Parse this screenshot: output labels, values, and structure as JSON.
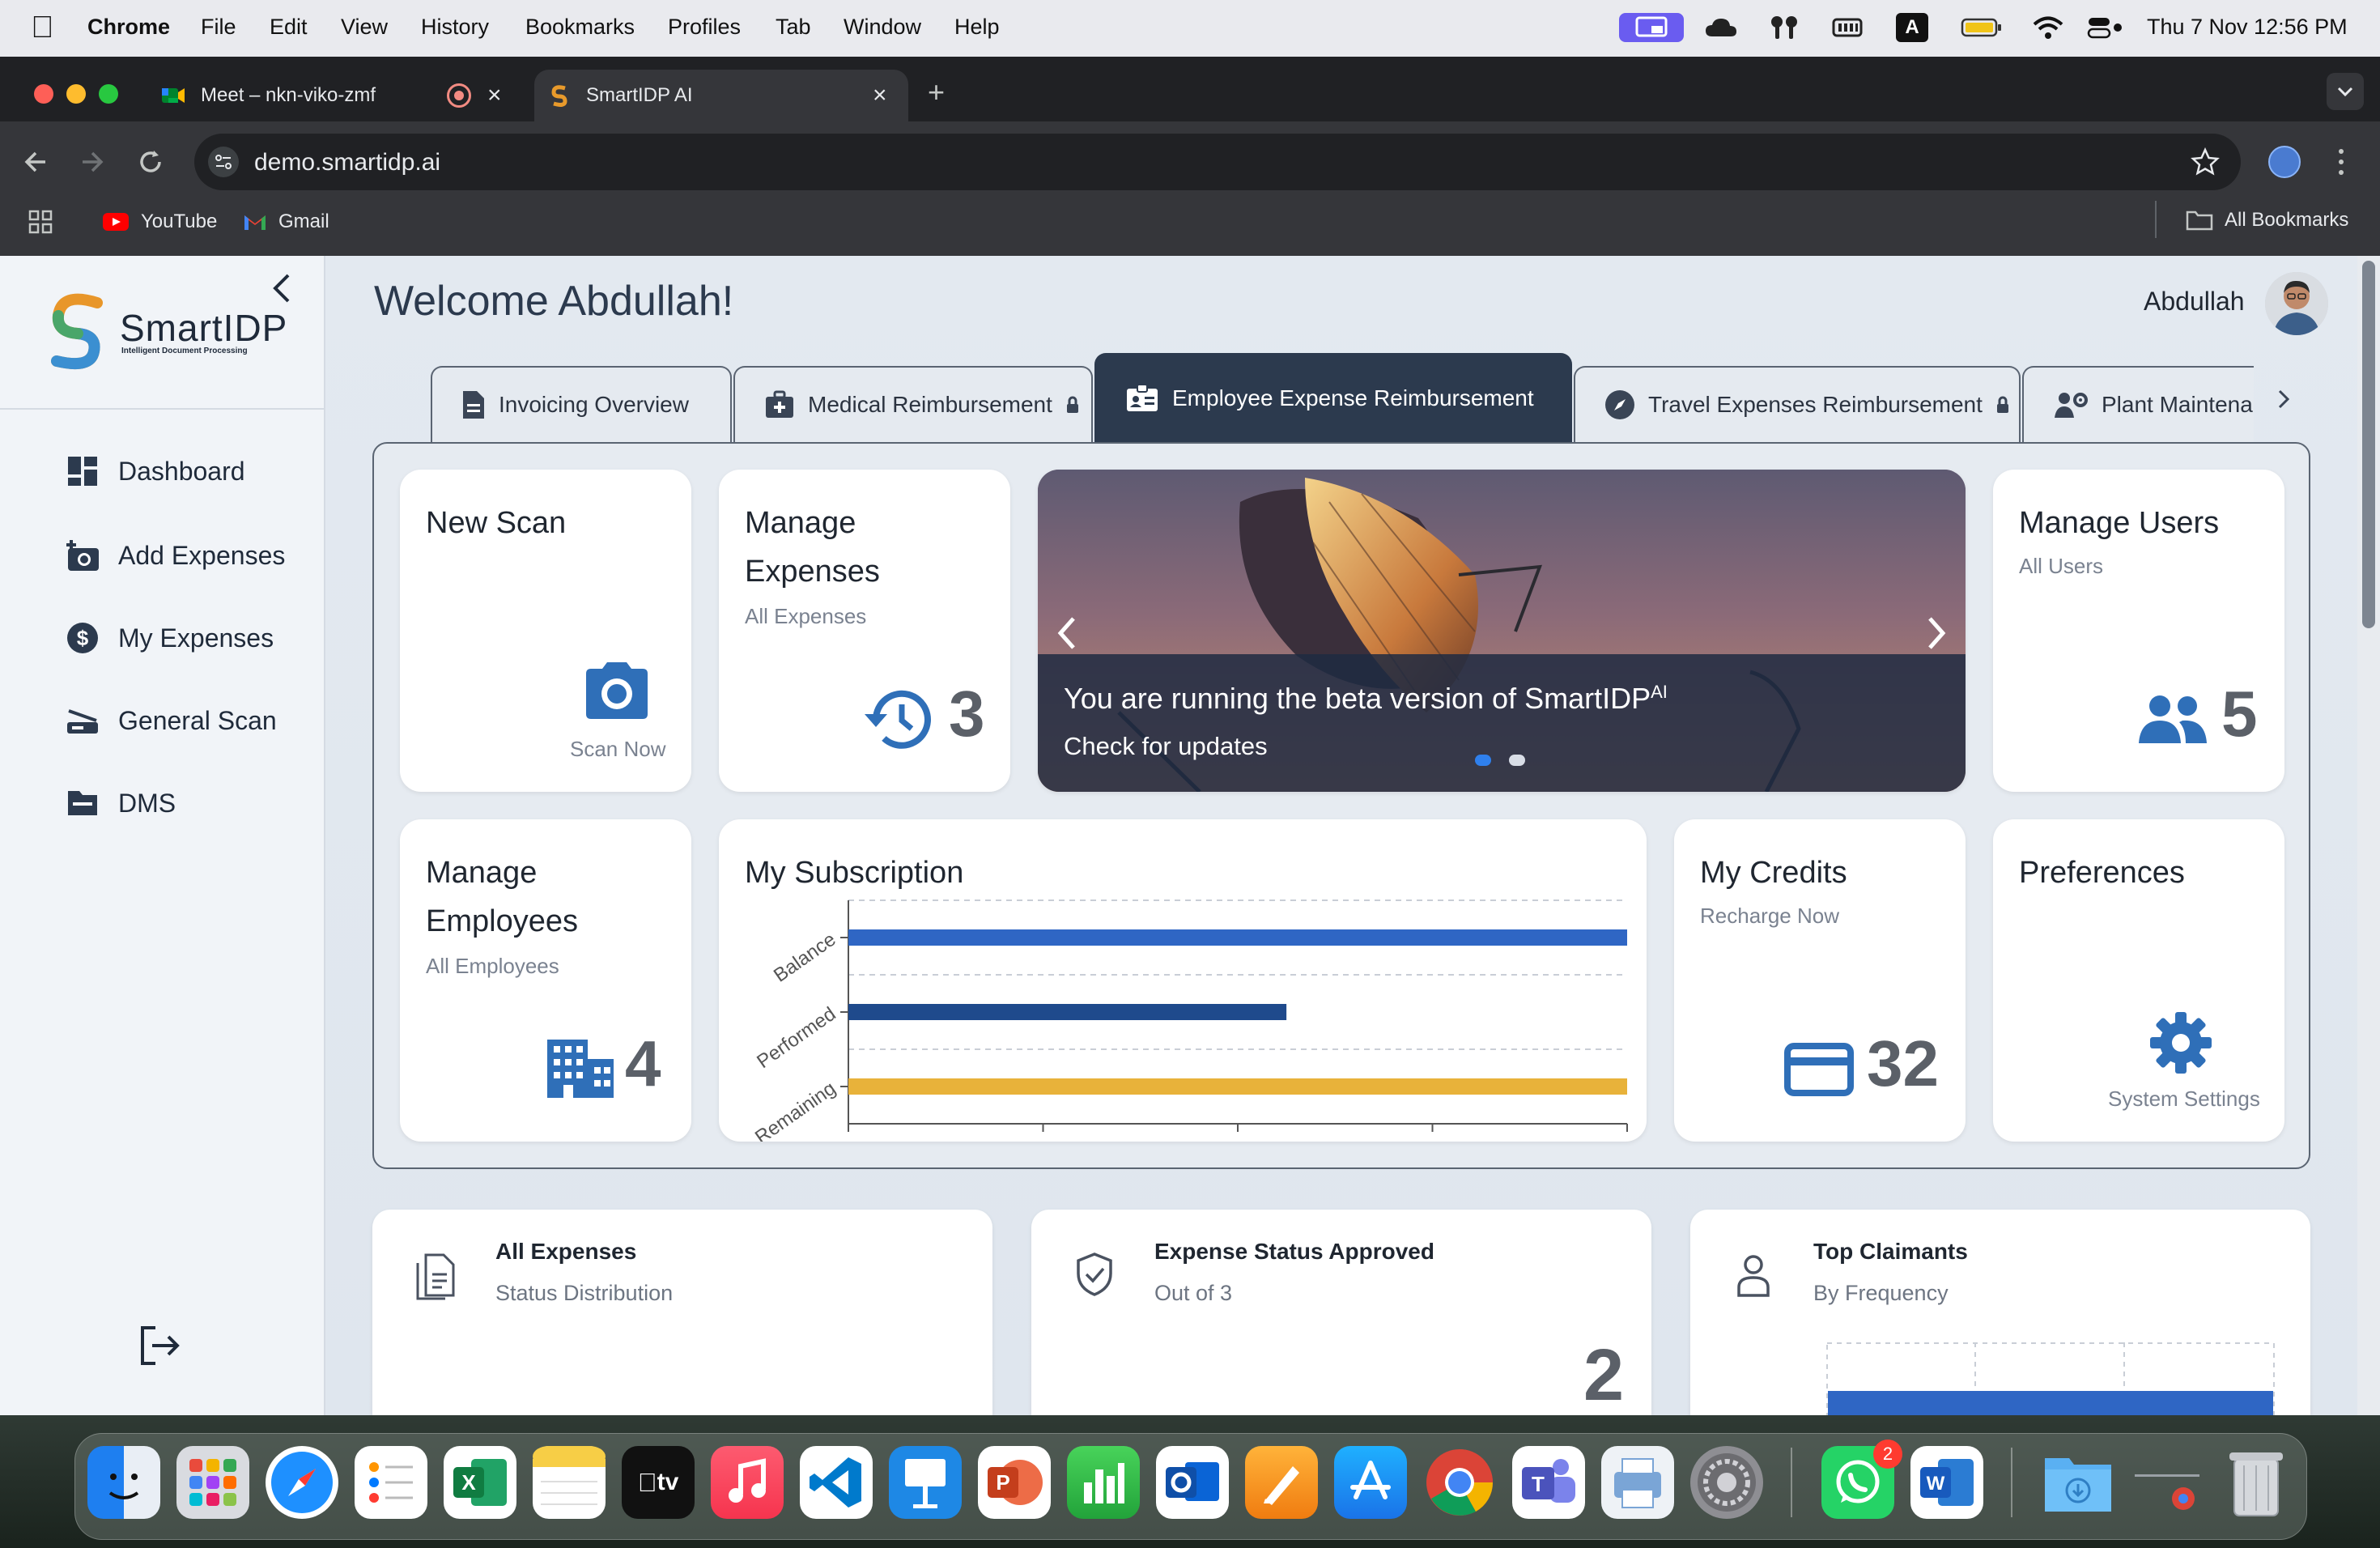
{
  "menubar": {
    "items": [
      "Chrome",
      "File",
      "Edit",
      "View",
      "History",
      "Bookmarks",
      "Profiles",
      "Tab",
      "Window",
      "Help"
    ],
    "keyboard_label": "A",
    "clock": "Thu 7 Nov  12:56 PM"
  },
  "browser": {
    "tabs": [
      {
        "title": "Meet – nkn-viko-zmf"
      },
      {
        "title": "SmartIDP AI"
      }
    ],
    "url": "demo.smartidp.ai",
    "bookmarks": [
      "YouTube",
      "Gmail"
    ],
    "all_bookmarks": "All Bookmarks"
  },
  "sidebar": {
    "logo_text": "SmartIDP",
    "logo_tagline": "Intelligent Document Processing",
    "items": [
      {
        "label": "Dashboard"
      },
      {
        "label": "Add Expenses"
      },
      {
        "label": "My Expenses"
      },
      {
        "label": "General Scan"
      },
      {
        "label": "DMS"
      }
    ]
  },
  "header": {
    "welcome": "Welcome Abdullah!",
    "user_name": "Abdullah"
  },
  "tabs": [
    {
      "label": "Invoicing Overview"
    },
    {
      "label": "Medical Reimbursement"
    },
    {
      "label": "Employee Expense Reimbursement"
    },
    {
      "label": "Travel Expenses Reimbursement"
    },
    {
      "label": "Plant Maintena"
    }
  ],
  "cards": {
    "new_scan": {
      "title": "New Scan",
      "action": "Scan Now"
    },
    "manage_expenses": {
      "title": "Manage Expenses",
      "sub": "All Expenses",
      "count": "3"
    },
    "banner": {
      "text": "You are running the beta version of SmartIDP",
      "sup": "AI",
      "link": "Check for updates"
    },
    "manage_users": {
      "title": "Manage Users",
      "sub": "All Users",
      "count": "5"
    },
    "manage_employees": {
      "title": "Manage Employees",
      "sub": "All Employees",
      "count": "4"
    },
    "subscription": {
      "title": "My Subscription"
    },
    "credits": {
      "title": "My Credits",
      "sub": "Recharge Now",
      "count": "32"
    },
    "preferences": {
      "title": "Preferences",
      "action": "System Settings"
    }
  },
  "chart_data": {
    "type": "bar",
    "orientation": "horizontal",
    "categories": [
      "Balance",
      "Performed",
      "Remaining"
    ],
    "values": [
      32,
      18,
      32
    ],
    "colors": [
      "#2f66c4",
      "#1f4a8c",
      "#e8b23a"
    ],
    "xlim": [
      0,
      32
    ],
    "xticks": [
      "0",
      "8",
      "16",
      "24",
      "32"
    ],
    "grid": true
  },
  "bottom_cards": [
    {
      "title": "All Expenses",
      "sub": "Status Distribution"
    },
    {
      "title": "Expense Status Approved",
      "sub": "Out of 3",
      "value": "2"
    },
    {
      "title": "Top Claimants",
      "sub": "By Frequency"
    }
  ],
  "dock": {
    "whatsapp_badge": "2",
    "tv_label": "tv"
  },
  "colors": {
    "accent_blue": "#2f6fb8",
    "tab_active": "#2c3a4e"
  }
}
